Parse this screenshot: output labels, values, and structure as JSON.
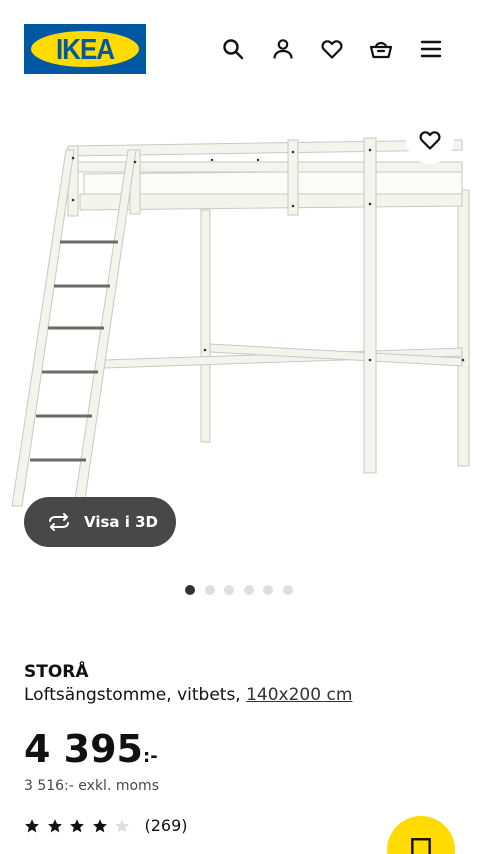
{
  "header": {
    "logo_text": "IKEA",
    "icons": [
      "search-icon",
      "user-icon",
      "heart-icon",
      "basket-icon",
      "menu-icon"
    ],
    "brand_blue": "#0058a3",
    "brand_yellow": "#ffdb00"
  },
  "gallery": {
    "view3d_label": "Visa i 3D",
    "image_count": 6,
    "active_index": 0
  },
  "product": {
    "name": "STORÅ",
    "description": "Loftsängstomme, vitbets, ",
    "size": "140x200 cm",
    "price_main": "4 395",
    "price_suffix": ":-",
    "price_ex_vat": "3 516:- exkl. moms",
    "rating_value": 4,
    "rating_max": 5,
    "rating_count": "(269)"
  }
}
